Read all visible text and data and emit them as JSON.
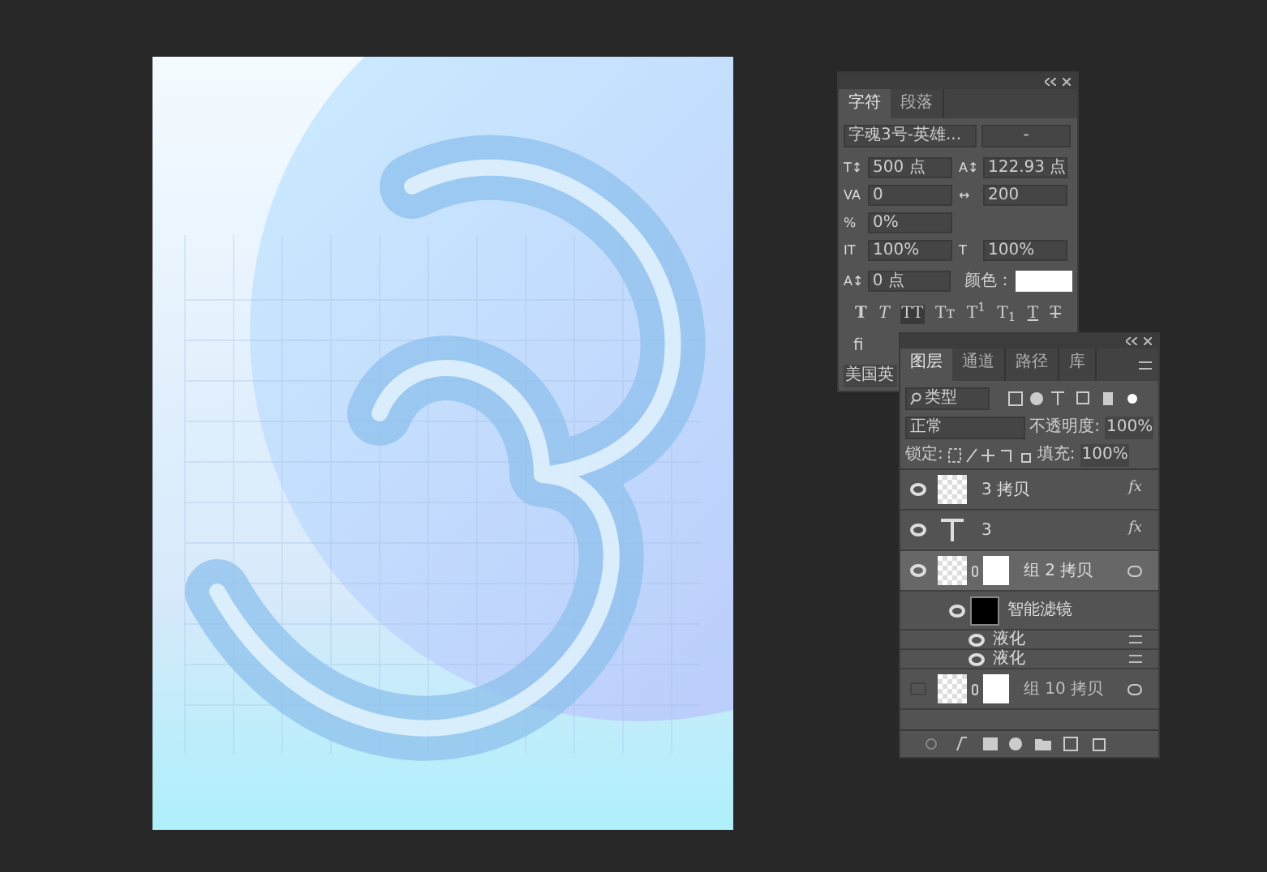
{
  "character_panel": {
    "tabs": [
      {
        "label": "字符",
        "selected": true
      },
      {
        "label": "段落",
        "selected": false
      }
    ],
    "font_family": "字魂3号-英雄...",
    "font_style": "-",
    "metric_rows": [
      [
        {
          "icon": "T↕",
          "value": "500 点"
        },
        {
          "icon": "A↕",
          "value": "122.93 点"
        }
      ],
      [
        {
          "icon": "VA",
          "value": "0"
        },
        {
          "icon": "↔",
          "value": "200"
        }
      ],
      [
        {
          "icon": "%",
          "value": "0%"
        }
      ],
      [
        {
          "icon": "IT",
          "value": "100%"
        },
        {
          "icon": "T",
          "value": "100%"
        }
      ]
    ],
    "baseline_icon": "A↕",
    "baseline_shift": "0 点",
    "color_label": "颜色：",
    "style_buttons": [
      {
        "label": "T",
        "kind": "bold",
        "selected": false
      },
      {
        "label": "T",
        "kind": "italic",
        "selected": false
      },
      {
        "label": "TT",
        "kind": "caps",
        "selected": true
      },
      {
        "label": "Tт",
        "kind": "smallcaps",
        "selected": false
      },
      {
        "label": "T$^{1}$",
        "kind": "super",
        "selected": false
      },
      {
        "label": "T$_{1}$",
        "kind": "sub",
        "selected": false
      },
      {
        "label": "T",
        "kind": "underline",
        "selected": false
      },
      {
        "label": "T",
        "kind": "strike",
        "selected": false
      }
    ],
    "ligature": "fi",
    "language": "美国英"
  },
  "layers_panel": {
    "tabs": [
      {
        "label": "图层",
        "selected": true
      },
      {
        "label": "通道",
        "selected": false
      },
      {
        "label": "路径",
        "selected": false
      },
      {
        "label": "库",
        "selected": false
      }
    ],
    "filter_kind": "类型",
    "blend_mode": "正常",
    "opacity_label": "不透明度:",
    "opacity": "100%",
    "lock_label": "锁定:",
    "fill_label": "填充:",
    "fill": "100%",
    "layers": [
      {
        "name": "3 拷贝",
        "kind": "pixel",
        "visible": true,
        "selected": false,
        "fx_label": "fx"
      },
      {
        "name": "3",
        "kind": "text",
        "visible": true,
        "selected": false,
        "fx_label": "fx"
      },
      {
        "name": "组 2 拷贝",
        "kind": "smart",
        "visible": true,
        "selected": true
      },
      {
        "name": "智能滤镜",
        "kind": "filter_mask",
        "visible": true,
        "selected": false
      },
      {
        "name": "液化",
        "kind": "filter",
        "visible": true,
        "selected": false
      },
      {
        "name": "液化",
        "kind": "filter",
        "visible": true,
        "selected": false
      },
      {
        "name": "组 10 拷贝",
        "kind": "smart",
        "visible": false,
        "selected": false
      }
    ]
  }
}
